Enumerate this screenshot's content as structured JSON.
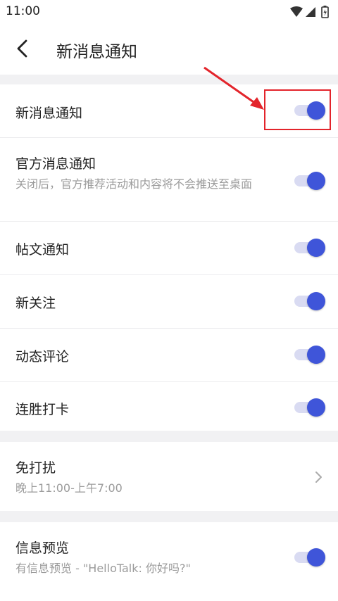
{
  "status_bar": {
    "time": "11:00",
    "icons": [
      "wifi-icon",
      "signal-icon",
      "battery-charging-icon"
    ]
  },
  "header": {
    "title": "新消息通知",
    "back_icon": "chevron-left-icon"
  },
  "notifications": [
    {
      "key": "new_message",
      "label": "新消息通知",
      "enabled": true
    },
    {
      "key": "official",
      "label": "官方消息通知",
      "subtitle": "关闭后，官方推荐活动和内容将不会推送至桌面",
      "enabled": true
    },
    {
      "key": "post",
      "label": "帖文通知",
      "enabled": true
    },
    {
      "key": "follow",
      "label": "新关注",
      "enabled": true
    },
    {
      "key": "comment",
      "label": "动态评论",
      "enabled": true
    },
    {
      "key": "streak",
      "label": "连胜打卡",
      "enabled": true
    }
  ],
  "dnd": {
    "label": "免打扰",
    "value": "晚上11:00-上午7:00",
    "icon": "chevron-right-icon"
  },
  "preview": {
    "label": "信息预览",
    "subtitle": "有信息预览 - \"HelloTalk: 你好吗?\"",
    "enabled": true
  },
  "colors": {
    "accent": "#3f55d9",
    "toggle_track": "#d9dbf2",
    "annotation": "#e3242b",
    "background": "#f1f1f3"
  }
}
